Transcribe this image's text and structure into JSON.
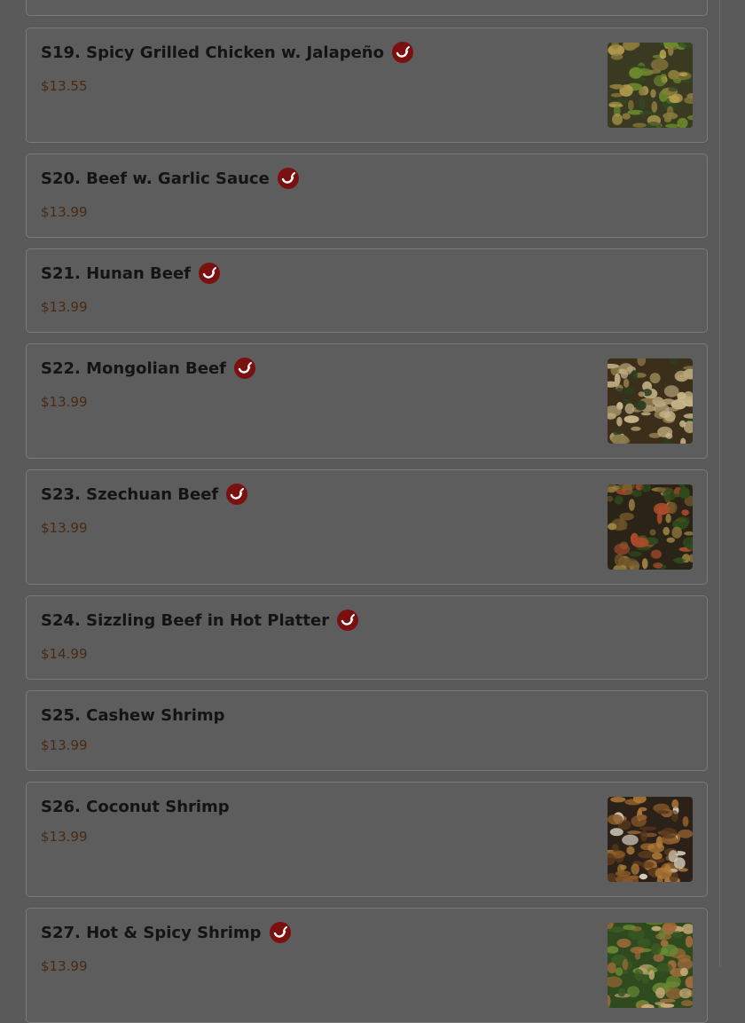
{
  "menu": {
    "items": [
      {
        "id": "s19",
        "name": "S19. Spicy Grilled Chicken w. Jalapeño",
        "price": "$13.55",
        "spicy": true,
        "image": true,
        "img_palette": [
          "#3a3a22",
          "#8a7a3c",
          "#b59d4f",
          "#2e4d1f",
          "#6b8a2c"
        ]
      },
      {
        "id": "s20",
        "name": "S20. Beef w. Garlic Sauce",
        "price": "$13.99",
        "spicy": true,
        "image": false
      },
      {
        "id": "s21",
        "name": "S21. Hunan Beef",
        "price": "$13.99",
        "spicy": true,
        "image": false
      },
      {
        "id": "s22",
        "name": "S22. Mongolian Beef",
        "price": "$13.99",
        "spicy": true,
        "image": true,
        "img_palette": [
          "#3b2f1c",
          "#8c7a4a",
          "#b8a57a",
          "#2c3d1f",
          "#c9b58a"
        ]
      },
      {
        "id": "s23",
        "name": "S23. Szechuan Beef",
        "price": "$13.99",
        "spicy": true,
        "image": true,
        "img_palette": [
          "#2a2418",
          "#6d5228",
          "#9a7f42",
          "#2c4a1c",
          "#a84a2a"
        ]
      },
      {
        "id": "s24",
        "name": "S24. Sizzling Beef in Hot Platter",
        "price": "$14.99",
        "spicy": true,
        "image": false
      },
      {
        "id": "s25",
        "name": "S25. Cashew Shrimp",
        "price": "$13.99",
        "spicy": false,
        "image": false
      },
      {
        "id": "s26",
        "name": "S26. Coconut Shrimp",
        "price": "$13.99",
        "spicy": false,
        "image": true,
        "img_palette": [
          "#2b2118",
          "#8a5a28",
          "#b07a3a",
          "#d8d0c0",
          "#5a3a1c"
        ]
      },
      {
        "id": "s27",
        "name": "S27. Hot & Spicy Shrimp",
        "price": "$13.99",
        "spicy": true,
        "image": true,
        "img_palette": [
          "#2e4a1e",
          "#6a8a34",
          "#a06a3a",
          "#c8a878",
          "#3a5a24"
        ]
      }
    ]
  }
}
